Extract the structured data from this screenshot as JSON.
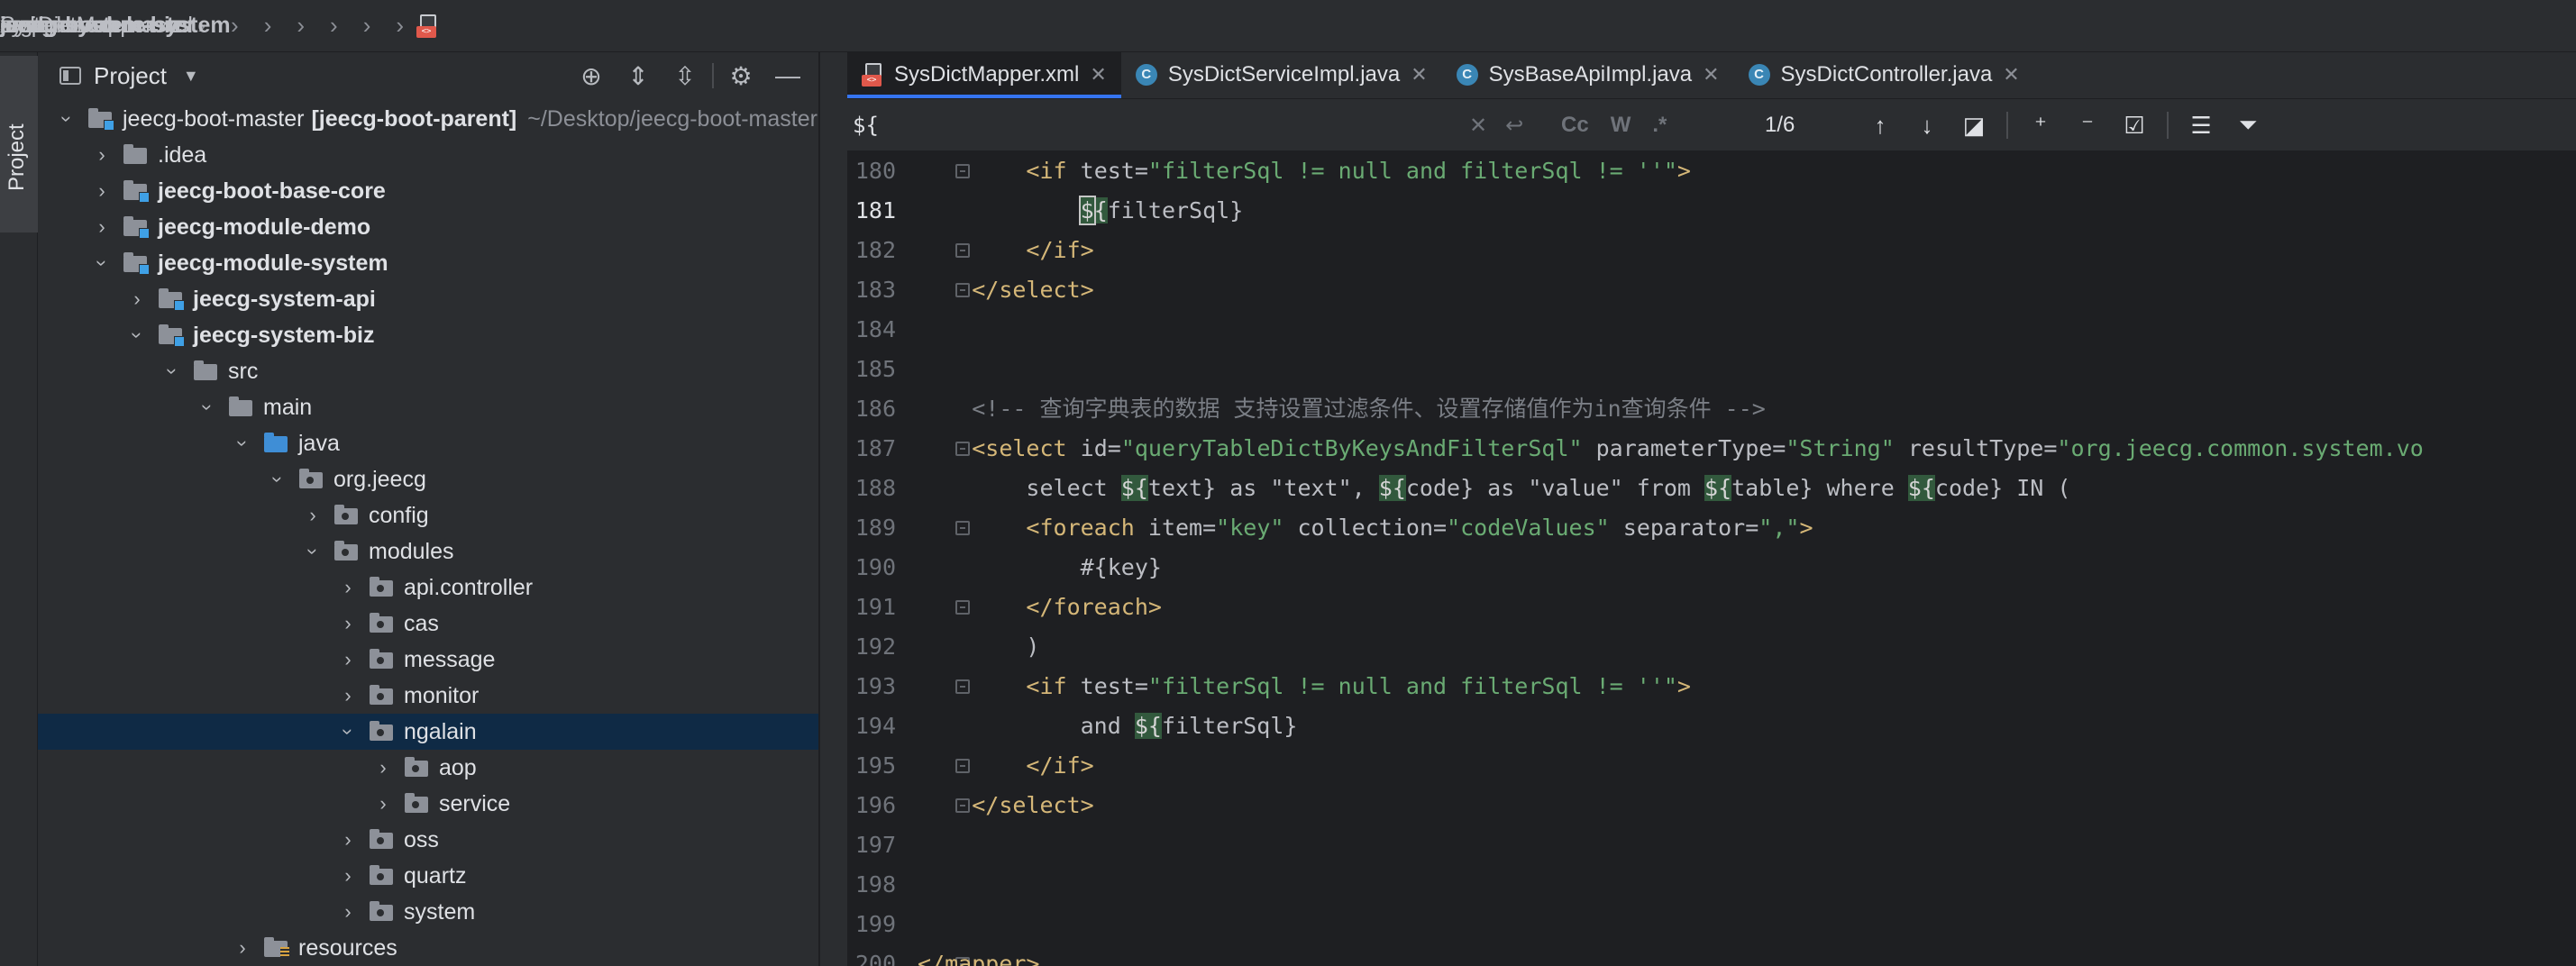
{
  "breadcrumb": [
    "jeecg-boot-master",
    "jeecg-module-system",
    "jeecg-system-biz",
    "src",
    "main",
    "java",
    "org",
    "jeecg",
    "modules",
    "system",
    "mapper",
    "xml",
    "SysDictMapper.xml"
  ],
  "strip": {
    "project_tab": "Project"
  },
  "project_panel": {
    "title": "Project",
    "tree": [
      {
        "name": "jeecg-boot-master",
        "extra_bold": "[jeecg-boot-parent]",
        "extra": "~/Desktop/jeecg-boot-master",
        "level": 0,
        "open": true,
        "kind": "mod"
      },
      {
        "name": ".idea",
        "level": 1,
        "open": false,
        "kind": "plain"
      },
      {
        "name": "jeecg-boot-base-core",
        "level": 1,
        "open": false,
        "kind": "mod",
        "bold": true
      },
      {
        "name": "jeecg-module-demo",
        "level": 1,
        "open": false,
        "kind": "mod",
        "bold": true
      },
      {
        "name": "jeecg-module-system",
        "level": 1,
        "open": true,
        "kind": "mod",
        "bold": true
      },
      {
        "name": "jeecg-system-api",
        "level": 2,
        "open": false,
        "kind": "mod",
        "bold": true
      },
      {
        "name": "jeecg-system-biz",
        "level": 2,
        "open": true,
        "kind": "mod",
        "bold": true
      },
      {
        "name": "src",
        "level": 3,
        "open": true,
        "kind": "plain"
      },
      {
        "name": "main",
        "level": 4,
        "open": true,
        "kind": "plain"
      },
      {
        "name": "java",
        "level": 5,
        "open": true,
        "kind": "src"
      },
      {
        "name": "org.jeecg",
        "level": 6,
        "open": true,
        "kind": "pkg"
      },
      {
        "name": "config",
        "level": 7,
        "open": false,
        "kind": "pkg"
      },
      {
        "name": "modules",
        "level": 7,
        "open": true,
        "kind": "pkg"
      },
      {
        "name": "api.controller",
        "level": 8,
        "open": false,
        "kind": "pkg"
      },
      {
        "name": "cas",
        "level": 8,
        "open": false,
        "kind": "pkg"
      },
      {
        "name": "message",
        "level": 8,
        "open": false,
        "kind": "pkg"
      },
      {
        "name": "monitor",
        "level": 8,
        "open": false,
        "kind": "pkg"
      },
      {
        "name": "ngalain",
        "level": 8,
        "open": true,
        "kind": "pkg",
        "selected": true
      },
      {
        "name": "aop",
        "level": 9,
        "open": false,
        "kind": "pkg"
      },
      {
        "name": "service",
        "level": 9,
        "open": false,
        "kind": "pkg"
      },
      {
        "name": "oss",
        "level": 8,
        "open": false,
        "kind": "pkg"
      },
      {
        "name": "quartz",
        "level": 8,
        "open": false,
        "kind": "pkg"
      },
      {
        "name": "system",
        "level": 8,
        "open": false,
        "kind": "pkg"
      },
      {
        "name": "resources",
        "level": 5,
        "open": false,
        "kind": "resb"
      }
    ]
  },
  "tabs": [
    {
      "label": "SysDictMapper.xml",
      "active": true,
      "icon": "xml-file-icon"
    },
    {
      "label": "SysDictServiceImpl.java",
      "active": false,
      "icon": "class-icon"
    },
    {
      "label": "SysBaseApiImpl.java",
      "active": false,
      "icon": "class-icon"
    },
    {
      "label": "SysDictController.java",
      "active": false,
      "icon": "class-icon"
    }
  ],
  "find": {
    "query": "${",
    "match_case": "Cc",
    "words": "W",
    "regex": ".*",
    "count": "1/6"
  },
  "code_lines": [
    {
      "n": "180",
      "fold": true,
      "segs": [
        [
          "",
          "        "
        ],
        [
          "tagc",
          "<if "
        ],
        [
          "attr",
          "test"
        ],
        [
          "",
          "="
        ],
        [
          "val",
          "\"filterSql != null and filterSql != ''\""
        ],
        [
          "tagc",
          ">"
        ]
      ]
    },
    {
      "n": "181",
      "cur": true,
      "segs": [
        [
          "",
          "            "
        ],
        [
          "hl caretbox",
          "$"
        ],
        [
          "hl",
          "{"
        ],
        [
          "",
          "filterSql}"
        ]
      ]
    },
    {
      "n": "182",
      "fold": true,
      "segs": [
        [
          "",
          "        "
        ],
        [
          "tagc",
          "</if>"
        ]
      ]
    },
    {
      "n": "183",
      "fold": true,
      "segs": [
        [
          "",
          "    "
        ],
        [
          "tagc",
          "</select>"
        ]
      ]
    },
    {
      "n": "184",
      "segs": []
    },
    {
      "n": "185",
      "segs": []
    },
    {
      "n": "186",
      "segs": [
        [
          "",
          "    "
        ],
        [
          "cmt",
          "<!-- 查询字典表的数据 支持设置过滤条件、设置存储值作为in查询条件 -->"
        ]
      ]
    },
    {
      "n": "187",
      "fold": true,
      "segs": [
        [
          "",
          "    "
        ],
        [
          "tagc",
          "<select "
        ],
        [
          "attr",
          "id"
        ],
        [
          "",
          "="
        ],
        [
          "val",
          "\"queryTableDictByKeysAndFilterSql\""
        ],
        [
          "",
          " "
        ],
        [
          "attr",
          "parameterType"
        ],
        [
          "",
          "="
        ],
        [
          "val",
          "\"String\""
        ],
        [
          "",
          " "
        ],
        [
          "attr",
          "resultType"
        ],
        [
          "",
          "="
        ],
        [
          "val",
          "\"org.jeecg.common.system.vo"
        ]
      ]
    },
    {
      "n": "188",
      "segs": [
        [
          "",
          "        select "
        ],
        [
          "hl",
          "${"
        ],
        [
          "",
          "text} as \"text\", "
        ],
        [
          "hl",
          "${"
        ],
        [
          "",
          "code} as \"value\" from "
        ],
        [
          "hl",
          "${"
        ],
        [
          "",
          "table} where "
        ],
        [
          "hl",
          "${"
        ],
        [
          "",
          "code} IN ("
        ]
      ]
    },
    {
      "n": "189",
      "fold": true,
      "segs": [
        [
          "",
          "        "
        ],
        [
          "tagc",
          "<foreach "
        ],
        [
          "attr",
          "item"
        ],
        [
          "",
          "="
        ],
        [
          "val",
          "\"key\""
        ],
        [
          "",
          " "
        ],
        [
          "attr",
          "collection"
        ],
        [
          "",
          "="
        ],
        [
          "val",
          "\"codeValues\""
        ],
        [
          "",
          " "
        ],
        [
          "attr",
          "separator"
        ],
        [
          "",
          "="
        ],
        [
          "val",
          "\",\""
        ],
        [
          "tagc",
          ">"
        ]
      ]
    },
    {
      "n": "190",
      "segs": [
        [
          "",
          "            #{key}"
        ]
      ]
    },
    {
      "n": "191",
      "fold": true,
      "segs": [
        [
          "",
          "        "
        ],
        [
          "tagc",
          "</foreach>"
        ]
      ]
    },
    {
      "n": "192",
      "segs": [
        [
          "",
          "        )"
        ]
      ]
    },
    {
      "n": "193",
      "fold": true,
      "segs": [
        [
          "",
          "        "
        ],
        [
          "tagc",
          "<if "
        ],
        [
          "attr",
          "test"
        ],
        [
          "",
          "="
        ],
        [
          "val",
          "\"filterSql != null and filterSql != ''\""
        ],
        [
          "tagc",
          ">"
        ]
      ]
    },
    {
      "n": "194",
      "segs": [
        [
          "",
          "            and "
        ],
        [
          "hl",
          "${"
        ],
        [
          "",
          "filterSql}"
        ]
      ]
    },
    {
      "n": "195",
      "fold": true,
      "segs": [
        [
          "",
          "        "
        ],
        [
          "tagc",
          "</if>"
        ]
      ]
    },
    {
      "n": "196",
      "fold": true,
      "segs": [
        [
          "",
          "    "
        ],
        [
          "tagc",
          "</select>"
        ]
      ]
    },
    {
      "n": "197",
      "segs": []
    },
    {
      "n": "198",
      "segs": []
    },
    {
      "n": "199",
      "segs": []
    },
    {
      "n": "200",
      "fold": true,
      "segs": [
        [
          "tagc",
          "</mapper>"
        ]
      ]
    }
  ]
}
